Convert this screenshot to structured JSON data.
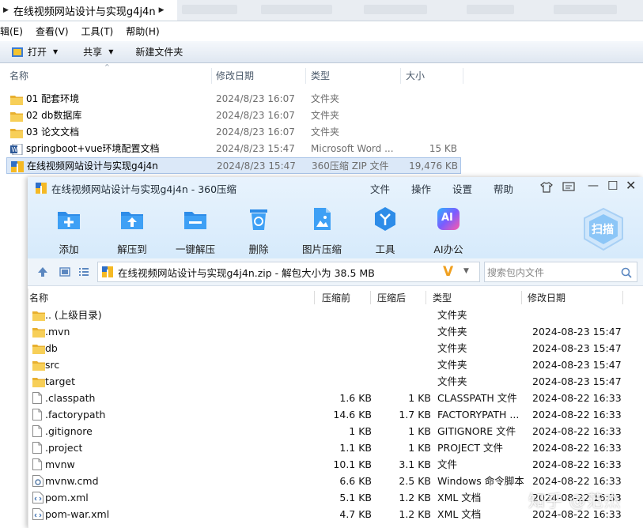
{
  "explorer": {
    "breadcrumb": "在线视频网站设计与实现g4j4n",
    "menu": [
      "编辑(E)",
      "查看(V)",
      "工具(T)",
      "帮助(H)"
    ],
    "toolbar": {
      "open": "打开",
      "share": "共享",
      "new_folder": "新建文件夹"
    },
    "columns": {
      "name": "名称",
      "date": "修改日期",
      "type": "类型",
      "size": "大小"
    },
    "rows": [
      {
        "name": "01 配套环境",
        "date": "2024/8/23 16:07",
        "type": "文件夹",
        "size": ""
      },
      {
        "name": "02 db数据库",
        "date": "2024/8/23 16:07",
        "type": "文件夹",
        "size": ""
      },
      {
        "name": "03 论文文档",
        "date": "2024/8/23 16:07",
        "type": "文件夹",
        "size": ""
      },
      {
        "name": "springboot+vue环境配置文档",
        "date": "2024/8/23 15:47",
        "type": "Microsoft Word ...",
        "size": "15 KB"
      },
      {
        "name": "在线视频网站设计与实现g4j4n",
        "date": "2024/8/23 15:47",
        "type": "360压缩 ZIP 文件",
        "size": "19,476 KB"
      }
    ]
  },
  "zip": {
    "title": "在线视频网站设计与实现g4j4n - 360压缩",
    "menu": [
      "文件",
      "操作",
      "设置",
      "帮助"
    ],
    "tools": [
      "添加",
      "解压到",
      "一键解压",
      "删除",
      "图片压缩",
      "工具",
      "AI办公"
    ],
    "scan_label": "扫描",
    "ai_icon_text": "AI",
    "address": "在线视频网站设计与实现g4j4n.zip - 解包大小为 38.5 MB",
    "search_placeholder": "搜索包内文件",
    "columns": {
      "name": "名称",
      "packed": "压缩前",
      "compressed": "压缩后",
      "type": "类型",
      "date": "修改日期"
    },
    "rows": [
      {
        "name": ".. (上级目录)",
        "packed": "",
        "compressed": "",
        "type": "文件夹",
        "date": "",
        "kind": "folder"
      },
      {
        "name": ".mvn",
        "packed": "",
        "compressed": "",
        "type": "文件夹",
        "date": "2024-08-23 15:47",
        "kind": "folder"
      },
      {
        "name": "db",
        "packed": "",
        "compressed": "",
        "type": "文件夹",
        "date": "2024-08-23 15:47",
        "kind": "folder"
      },
      {
        "name": "src",
        "packed": "",
        "compressed": "",
        "type": "文件夹",
        "date": "2024-08-23 15:47",
        "kind": "folder"
      },
      {
        "name": "target",
        "packed": "",
        "compressed": "",
        "type": "文件夹",
        "date": "2024-08-23 15:47",
        "kind": "folder"
      },
      {
        "name": ".classpath",
        "packed": "1.6 KB",
        "compressed": "1 KB",
        "type": "CLASSPATH 文件",
        "date": "2024-08-22 16:33",
        "kind": "file"
      },
      {
        "name": ".factorypath",
        "packed": "14.6 KB",
        "compressed": "1.7 KB",
        "type": "FACTORYPATH ...",
        "date": "2024-08-22 16:33",
        "kind": "file"
      },
      {
        "name": ".gitignore",
        "packed": "1 KB",
        "compressed": "1 KB",
        "type": "GITIGNORE 文件",
        "date": "2024-08-22 16:33",
        "kind": "file"
      },
      {
        "name": ".project",
        "packed": "1.1 KB",
        "compressed": "1 KB",
        "type": "PROJECT 文件",
        "date": "2024-08-22 16:33",
        "kind": "file"
      },
      {
        "name": "mvnw",
        "packed": "10.1 KB",
        "compressed": "3.1 KB",
        "type": "文件",
        "date": "2024-08-22 16:33",
        "kind": "file"
      },
      {
        "name": "mvnw.cmd",
        "packed": "6.6 KB",
        "compressed": "2.5 KB",
        "type": "Windows 命令脚本",
        "date": "2024-08-22 16:33",
        "kind": "cmd"
      },
      {
        "name": "pom.xml",
        "packed": "5.1 KB",
        "compressed": "1.2 KB",
        "type": "XML 文档",
        "date": "2024-08-22 16:33",
        "kind": "xml"
      },
      {
        "name": "pom-war.xml",
        "packed": "4.7 KB",
        "compressed": "1.2 KB",
        "type": "XML 文档",
        "date": "2024-08-22 16:33",
        "kind": "xml"
      }
    ]
  },
  "watermark": "知乎 @范杰"
}
